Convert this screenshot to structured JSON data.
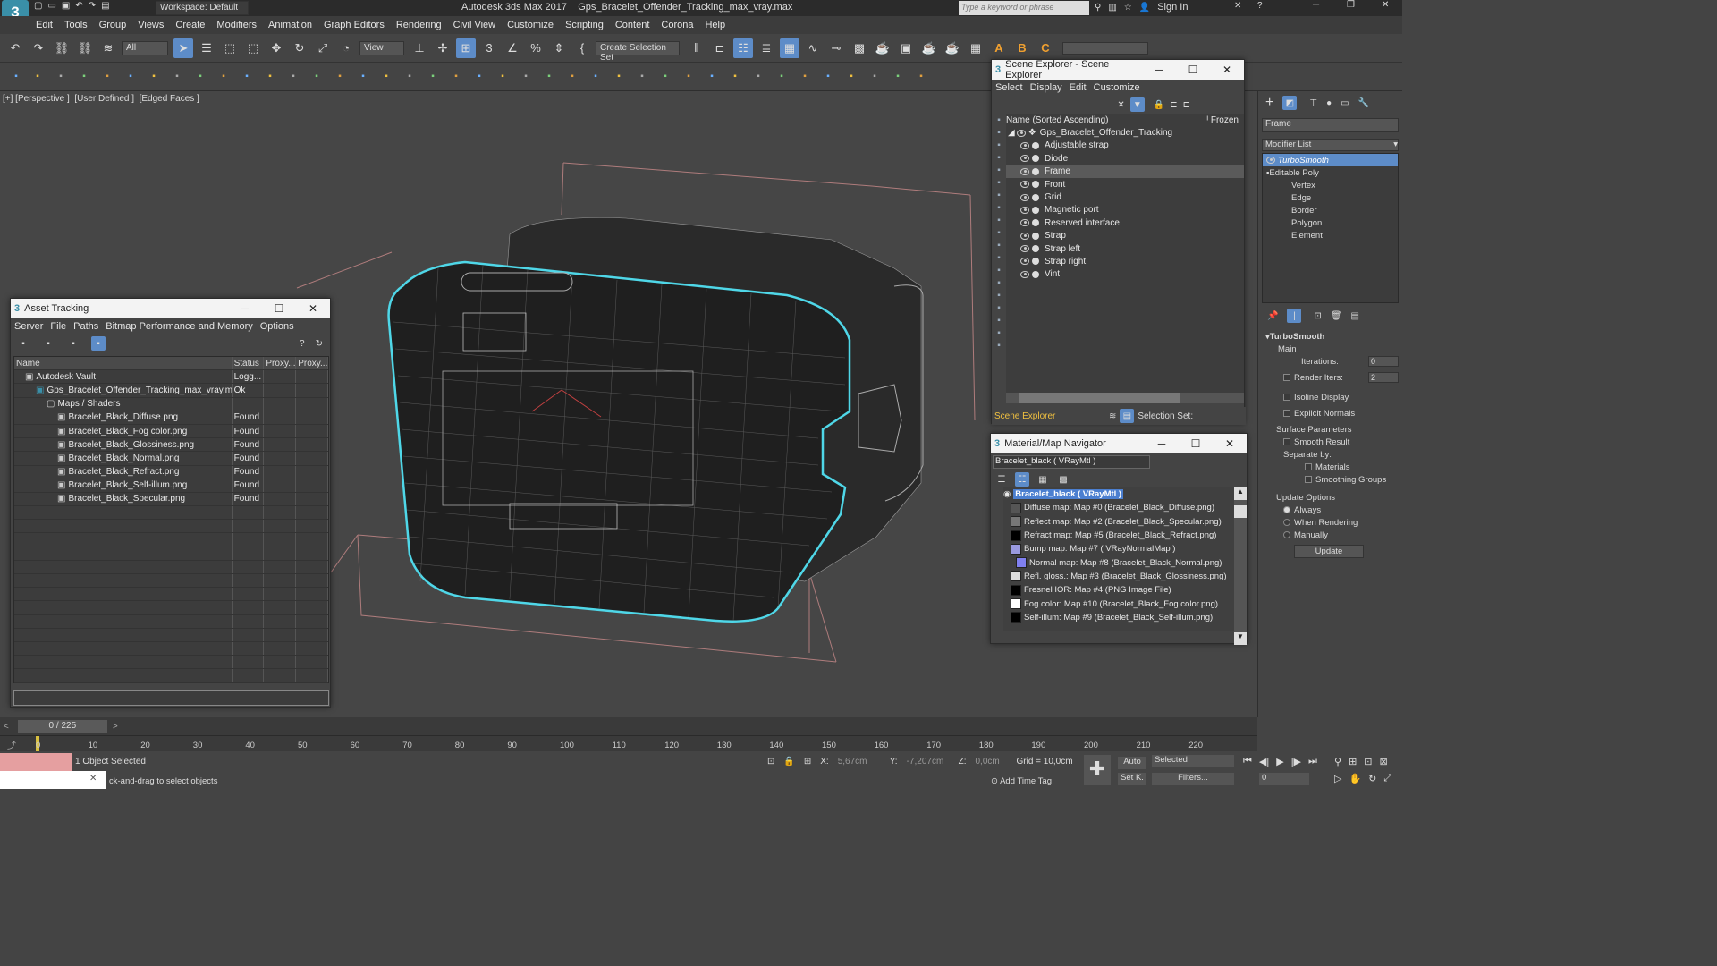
{
  "app": {
    "title": "Autodesk 3ds Max 2017    Gps_Bracelet_Offender_Tracking_max_vray.max",
    "workspace": "Workspace: Default",
    "search_placeholder": "Type a keyword or phrase",
    "sign_in": "Sign In"
  },
  "menu": [
    "Edit",
    "Tools",
    "Group",
    "Views",
    "Create",
    "Modifiers",
    "Animation",
    "Graph Editors",
    "Rendering",
    "Civil View",
    "Customize",
    "Scripting",
    "Content",
    "Corona",
    "Help"
  ],
  "toolbar": {
    "filter": "All",
    "view": "View",
    "selection_set": "Create Selection Set"
  },
  "viewport": {
    "label": "[+] [Perspective ]  [User Defined ]  [Edged Faces ]"
  },
  "asset": {
    "title": "Asset Tracking",
    "menu": [
      "Server",
      "File",
      "Paths",
      "Bitmap Performance and Memory",
      "Options"
    ],
    "columns": [
      "Name",
      "Status",
      "Proxy...",
      "Proxy..."
    ],
    "rows": [
      {
        "name": "Autodesk Vault",
        "status": "Logg...",
        "indent": 1
      },
      {
        "name": "Gps_Bracelet_Offender_Tracking_max_vray.max",
        "status": "Ok",
        "indent": 2
      },
      {
        "name": "Maps / Shaders",
        "status": "",
        "indent": 3
      },
      {
        "name": "Bracelet_Black_Diffuse.png",
        "status": "Found",
        "indent": 4
      },
      {
        "name": "Bracelet_Black_Fog color.png",
        "status": "Found",
        "indent": 4
      },
      {
        "name": "Bracelet_Black_Glossiness.png",
        "status": "Found",
        "indent": 4
      },
      {
        "name": "Bracelet_Black_Normal.png",
        "status": "Found",
        "indent": 4
      },
      {
        "name": "Bracelet_Black_Refract.png",
        "status": "Found",
        "indent": 4
      },
      {
        "name": "Bracelet_Black_Self-illum.png",
        "status": "Found",
        "indent": 4
      },
      {
        "name": "Bracelet_Black_Specular.png",
        "status": "Found",
        "indent": 4
      }
    ]
  },
  "scene": {
    "title": "Scene Explorer - Scene Explorer",
    "menu": [
      "Select",
      "Display",
      "Edit",
      "Customize"
    ],
    "col_name": "Name (Sorted Ascending)",
    "col_frozen": "ᴵ Frozen",
    "root": "Gps_Bracelet_Offender_Tracking",
    "items": [
      "Adjustable strap",
      "Diode",
      "Frame",
      "Front",
      "Grid",
      "Magnetic port",
      "Reserved interface",
      "Strap",
      "Strap left",
      "Strap right",
      "Vint"
    ],
    "selected": "Frame",
    "footer_left": "Scene Explorer",
    "footer_right": "Selection Set:"
  },
  "matnav": {
    "title": "Material/Map Navigator",
    "field": "Bracelet_black  ( VRayMtl )",
    "root": "Bracelet_black  ( VRayMtl )",
    "items": [
      {
        "label": "Diffuse map: Map #0 (Bracelet_Black_Diffuse.png)",
        "sw": "#555"
      },
      {
        "label": "Reflect map: Map #2 (Bracelet_Black_Specular.png)",
        "sw": "#777"
      },
      {
        "label": "Refract map: Map #5 (Bracelet_Black_Refract.png)",
        "sw": "#000"
      },
      {
        "label": "Bump map: Map #7  ( VRayNormalMap )",
        "sw": "#9a9ae0"
      },
      {
        "label": "Normal map: Map #8 (Bracelet_Black_Normal.png)",
        "sw": "#8080f0",
        "indent": true
      },
      {
        "label": "Refl. gloss.: Map #3 (Bracelet_Black_Glossiness.png)",
        "sw": "#ddd"
      },
      {
        "label": "Fresnel IOR: Map #4 (PNG Image File)",
        "sw": "#000"
      },
      {
        "label": "Fog color: Map #10 (Bracelet_Black_Fog color.png)",
        "sw": "#fff"
      },
      {
        "label": "Self-illum: Map #9 (Bracelet_Black_Self-illum.png)",
        "sw": "#000"
      }
    ]
  },
  "cmd": {
    "name": "Frame",
    "modifier_list": "Modifier List",
    "stack": [
      "TurboSmooth",
      "Editable Poly",
      "Vertex",
      "Edge",
      "Border",
      "Polygon",
      "Element"
    ],
    "rollout": "TurboSmooth",
    "main": "Main",
    "iterations_label": "Iterations:",
    "iterations": "0",
    "render_iters_label": "Render Iters:",
    "render_iters": "2",
    "isoline": "Isoline Display",
    "explicit": "Explicit Normals",
    "surface": "Surface Parameters",
    "smooth_result": "Smooth Result",
    "separate": "Separate by:",
    "materials": "Materials",
    "smoothing": "Smoothing Groups",
    "update_options": "Update Options",
    "always": "Always",
    "when_rendering": "When Rendering",
    "manually": "Manually",
    "update_btn": "Update"
  },
  "timeline": {
    "frame": "0 / 225",
    "ticks": [
      "0",
      "10",
      "20",
      "30",
      "40",
      "50",
      "60",
      "70",
      "80",
      "90",
      "100",
      "110",
      "120",
      "130",
      "140",
      "150",
      "160",
      "170",
      "180",
      "190",
      "200",
      "210",
      "220"
    ]
  },
  "status": {
    "selected": "1 Object Selected",
    "prompt": "ck-and-drag to select objects",
    "x_label": "X:",
    "x": "5,67cm",
    "y_label": "Y:",
    "y": "-7,207cm",
    "z_label": "Z:",
    "z": "0,0cm",
    "grid": "Grid = 10,0cm",
    "add_time_tag": "Add Time Tag",
    "auto": "Auto",
    "set_k": "Set K.",
    "selected_dd": "Selected",
    "filters": "Filters...",
    "frame_num": "0"
  },
  "colors": {
    "accent": "#5d8cc8",
    "selection_outline": "#4fd7e8",
    "wire": "#b9b9b9",
    "bbox": "#c98a8a"
  }
}
